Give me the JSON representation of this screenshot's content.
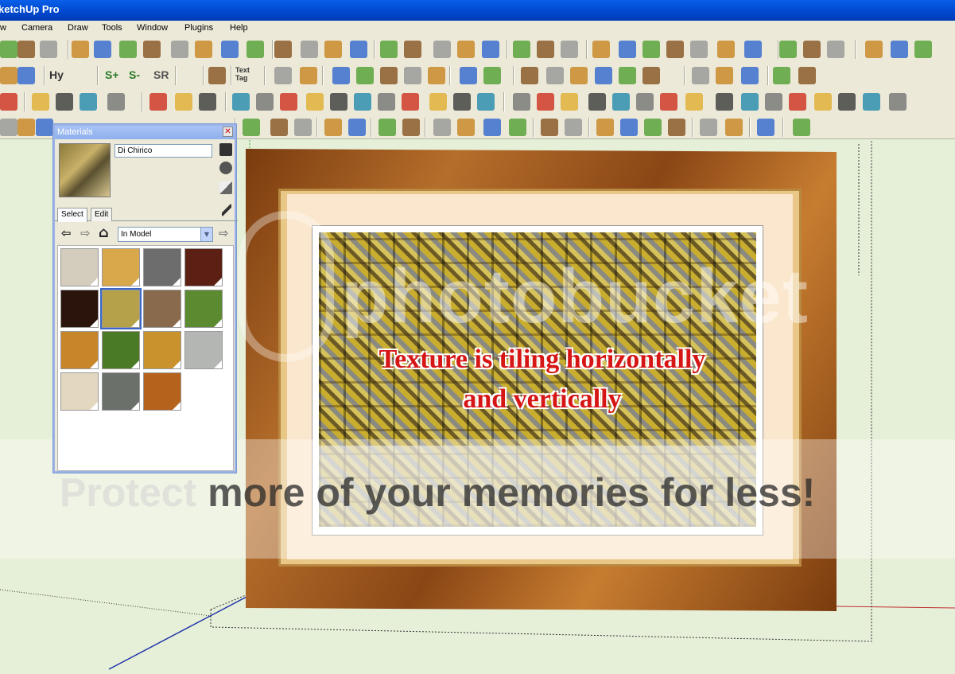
{
  "app": {
    "title": "SketchUp Pro",
    "title_visible": "ketchUp Pro"
  },
  "menu": [
    "w",
    "Camera",
    "Draw",
    "Tools",
    "Window",
    "Plugins",
    "Help"
  ],
  "toolbar": {
    "row2_text": [
      "Hy",
      "S+",
      "S-",
      "SR"
    ],
    "text_tag": "Text\nTag"
  },
  "materials": {
    "title": "Materials",
    "close_glyph": "✕",
    "current_material": "Di Chirico",
    "tabs": [
      "Select",
      "Edit"
    ],
    "library": "In Model",
    "nav": {
      "back": "⇦",
      "forward": "⇨",
      "home": "⌂"
    },
    "swatches": [
      {
        "name": "beige",
        "color": "#d4ccbc"
      },
      {
        "name": "light-wood",
        "color": "#d9a84a"
      },
      {
        "name": "dark-grey",
        "color": "#6d6d6d"
      },
      {
        "name": "dark-red-brown",
        "color": "#5b1f14"
      },
      {
        "name": "dark-brown",
        "color": "#2a140c"
      },
      {
        "name": "di-chirico",
        "color": "#b5a14a"
      },
      {
        "name": "bark",
        "color": "#8a6a4c"
      },
      {
        "name": "green-leaf-1",
        "color": "#5c8a30"
      },
      {
        "name": "autumn-leaf",
        "color": "#c8862a"
      },
      {
        "name": "green-leaf-2",
        "color": "#4a7a25"
      },
      {
        "name": "gold-stripes",
        "color": "#c9922c"
      },
      {
        "name": "granite",
        "color": "#b4b6b3"
      },
      {
        "name": "cream-stone",
        "color": "#e4d7c0"
      },
      {
        "name": "slate-grey",
        "color": "#6b706b"
      },
      {
        "name": "orange-wood",
        "color": "#b5621b"
      }
    ],
    "selected_index": 5
  },
  "viewport": {
    "annotation_line1": "Texture is tiling horizontally",
    "annotation_line2": "and vertically"
  },
  "watermark": {
    "logo": "photobucket",
    "text_part1": "Protect ",
    "text_part2": "more of your memories for less!"
  },
  "colors": {
    "titlebar": "#0048d0",
    "chrome": "#ece9d8",
    "viewport_bg": "#e6efd8",
    "annotation": "#d61515"
  }
}
